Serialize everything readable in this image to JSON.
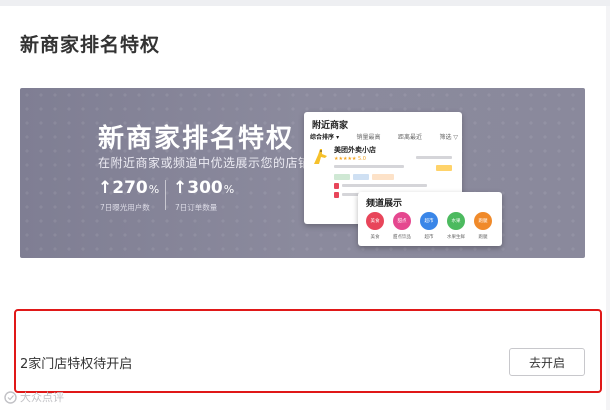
{
  "page": {
    "title": "新商家排名特权"
  },
  "banner": {
    "headline": "新商家排名特权",
    "subline": "在附近商家或频道中优选展示您的店铺",
    "stats": [
      {
        "value": "↑270",
        "unit": "%",
        "caption": "7日曝光用户数"
      },
      {
        "value": "↑300",
        "unit": "%",
        "caption": "7日订单数量"
      }
    ],
    "mock_list": {
      "header": "附近商家",
      "tabs": [
        "综合排序 ▾",
        "销量最高",
        "距离最近",
        "筛选 ▽"
      ],
      "shop_name": "美团外卖小店",
      "rating": "★★★★★ 5.0"
    },
    "mock_channel": {
      "header": "频道展示",
      "items": [
        {
          "icon": "美食",
          "label": "美食",
          "color": "#e8455a"
        },
        {
          "icon": "甜点",
          "label": "甜点饮品",
          "color": "#e5478f"
        },
        {
          "icon": "超市",
          "label": "超市",
          "color": "#3a86e8"
        },
        {
          "icon": "水果",
          "label": "水果生鲜",
          "color": "#4cba5f"
        },
        {
          "icon": "跑腿",
          "label": "跑腿",
          "color": "#f08a2a"
        }
      ]
    }
  },
  "privilege": {
    "status_text": "2家门店特权待开启",
    "button_label": "去开启"
  },
  "watermark": {
    "text": "大众点评"
  },
  "colors": {
    "highlight_border": "#e01818",
    "banner_bg": "#8a899c"
  }
}
